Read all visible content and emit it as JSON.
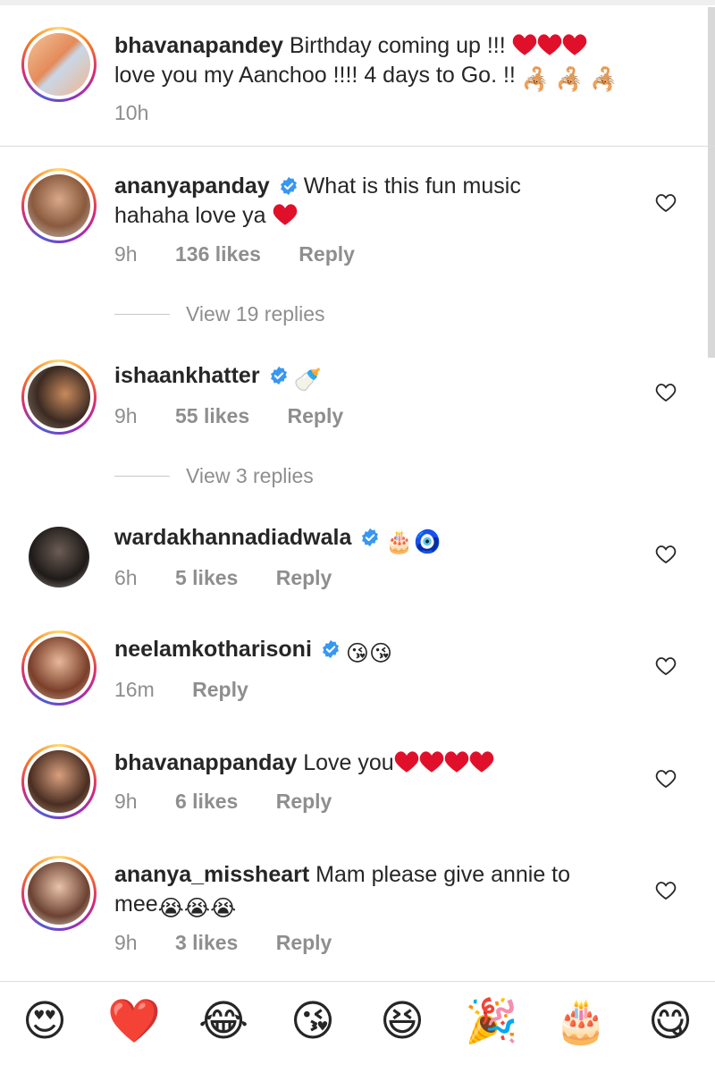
{
  "caption": {
    "username": "bhavanapandey",
    "text_line1": "Birthday coming up !!!",
    "text_line2": "love you my Aanchoo !!!! 4 days to Go. !!",
    "scorpion_emojis": [
      "🦂",
      "🦂",
      "🦂"
    ],
    "time": "10h"
  },
  "comments": [
    {
      "username": "ananyapanday",
      "verified": true,
      "text_line1": "What is this fun music",
      "text_line2": "hahaha love ya",
      "time": "9h",
      "likes": "136 likes",
      "reply": "Reply",
      "view_replies": "View 19 replies"
    },
    {
      "username": "ishaankhatter",
      "verified": true,
      "emoji": "🍼",
      "time": "9h",
      "likes": "55 likes",
      "reply": "Reply",
      "view_replies": "View 3 replies"
    },
    {
      "username": "wardakhannadiadwala",
      "verified": true,
      "emoji": "🎂🧿",
      "time": "6h",
      "likes": "5 likes",
      "reply": "Reply"
    },
    {
      "username": "neelamkotharisoni",
      "verified": true,
      "emoji": "😘😘",
      "time": "16m",
      "reply": "Reply"
    },
    {
      "username": "bhavanappanday",
      "verified": false,
      "text_line1": "Love you",
      "time": "9h",
      "likes": "6 likes",
      "reply": "Reply"
    },
    {
      "username": "ananya_missheart",
      "verified": false,
      "text_line1": "Mam please give annie to",
      "text_line2": "mee",
      "emoji": "😭😭😭",
      "time": "9h",
      "likes": "3 likes",
      "reply": "Reply"
    }
  ],
  "emoji_bar": [
    "😍",
    "❤️",
    "😂",
    "😘",
    "😆",
    "🎉",
    "🎂",
    "😋"
  ],
  "colors": {
    "verified_blue": "#3897f0",
    "heart_red": "#e0102b",
    "secondary_text": "#8e8e8e",
    "primary_text": "#262626"
  }
}
